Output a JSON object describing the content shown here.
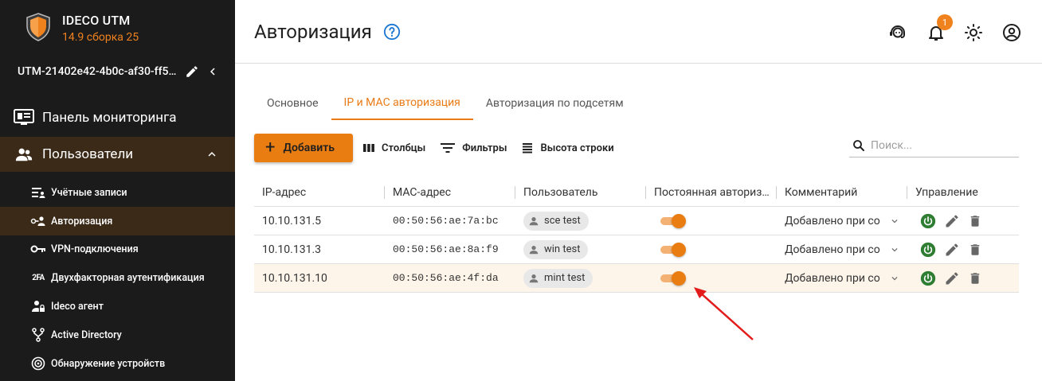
{
  "app": {
    "name": "IDECO UTM",
    "version": "14.9 сборка 25"
  },
  "server": {
    "name": "UTM-21402e42-4b0c-af30-ff5…"
  },
  "nav": {
    "monitoring": "Панель мониторинга",
    "users": "Пользователи",
    "sub": [
      {
        "label": "Учётные записи",
        "icon": "accounts-icon"
      },
      {
        "label": "Авторизация",
        "icon": "auth-icon"
      },
      {
        "label": "VPN-подключения",
        "icon": "key-icon"
      },
      {
        "label": "Двухфакторная аутентификация",
        "icon": "2fa-icon"
      },
      {
        "label": "Ideco агент",
        "icon": "agent-icon"
      },
      {
        "label": "Active Directory",
        "icon": "fork-icon"
      },
      {
        "label": "Обнаружение устройств",
        "icon": "radar-icon"
      }
    ]
  },
  "header": {
    "title": "Авторизация",
    "notifications": "1"
  },
  "tabs": [
    "Основное",
    "IP и MAC авторизация",
    "Авторизация по подсетям"
  ],
  "toolbar": {
    "add": "Добавить",
    "columns": "Столбцы",
    "filters": "Фильтры",
    "row_height": "Высота строки"
  },
  "search": {
    "placeholder": "Поиск..."
  },
  "table": {
    "headers": [
      "IP-адрес",
      "MAC-адрес",
      "Пользователь",
      "Постоянная авториз…",
      "Комментарий",
      "Управление"
    ],
    "rows": [
      {
        "ip": "10.10.131.5",
        "mac": "00:50:56:ae:7a:bc",
        "user": "sce test",
        "permanent": true,
        "comment": "Добавлено при со"
      },
      {
        "ip": "10.10.131.3",
        "mac": "00:50:56:ae:8a:f9",
        "user": "win test",
        "permanent": true,
        "comment": "Добавлено при со"
      },
      {
        "ip": "10.10.131.10",
        "mac": "00:50:56:ae:4f:da",
        "user": "mint test",
        "permanent": true,
        "comment": "Добавлено при со"
      }
    ]
  },
  "colors": {
    "accent": "#ea7d12",
    "sidebar": "#1b1b1b",
    "power": "#2e7d32"
  }
}
